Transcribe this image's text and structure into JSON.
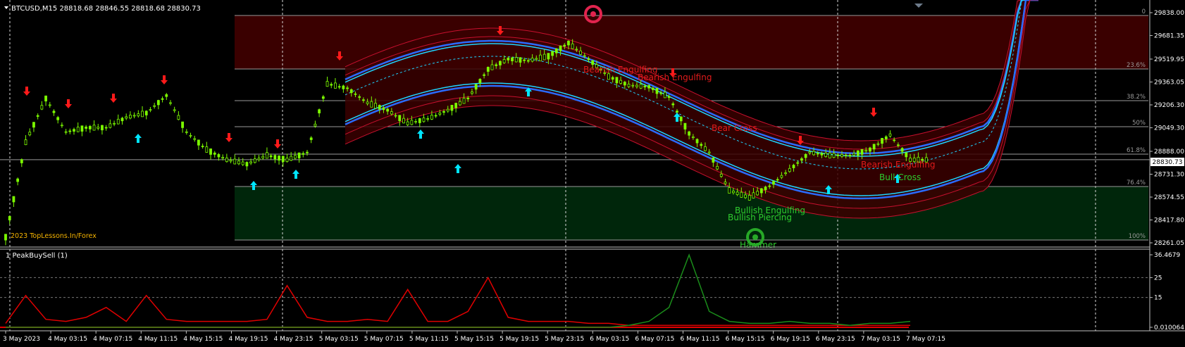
{
  "header": {
    "symbol_text": "BTCUSD,M15  28818.68 28846.55 28818.68 28830.73",
    "watermark": "2023 TopLessons.In/Forex"
  },
  "indicator": {
    "title": "1 PeakBuySell (1)",
    "axis_labels": [
      "36.4679",
      "25",
      "15",
      "0.010064"
    ]
  },
  "price_axis": {
    "labels": [
      "29838.00",
      "29681.35",
      "29519.95",
      "29363.05",
      "29206.30",
      "29049.30",
      "28888.00",
      "28731.30",
      "28574.55",
      "28417.80",
      "28261.05"
    ],
    "current_price": "28830.73"
  },
  "fibonacci": {
    "levels": [
      "0",
      "23.6%",
      "38.2%",
      "50%",
      "61.8%",
      "76.4%",
      "100%"
    ]
  },
  "time_axis": {
    "labels": [
      "3 May 2023",
      "4 May 03:15",
      "4 May 07:15",
      "4 May 11:15",
      "4 May 15:15",
      "4 May 19:15",
      "4 May 23:15",
      "5 May 03:15",
      "5 May 07:15",
      "5 May 11:15",
      "5 May 15:15",
      "5 May 19:15",
      "5 May 23:15",
      "6 May 03:15",
      "6 May 07:15",
      "6 May 11:15",
      "6 May 15:15",
      "6 May 19:15",
      "6 May 23:15",
      "7 May 03:15",
      "7 May 07:15"
    ]
  },
  "patterns": {
    "bearish_engulfing": "Bearish Engulfing",
    "bear_cross": "Bear Cross",
    "bullish_engulfing": "Bullish Engulfing",
    "bullish_piercing": "Bullish Piercing",
    "hammer": "Hammer",
    "bull_cross": "Bull Cross"
  },
  "colors": {
    "background": "#000000",
    "candle": "#7cfc00",
    "bear_zone": "#3a0000",
    "bull_zone": "#00260b",
    "sell_arrow": "#ff1a1a",
    "buy_arrow": "#00e5ff",
    "band_blue": "#2a6bff",
    "band_cyan": "#1ed4ff",
    "band_red": "#c8102e",
    "indicator_red": "#e00000",
    "indicator_green": "#1a8c1a"
  },
  "chart_data": [
    {
      "type": "candlestick",
      "title": "BTCUSD,M15",
      "ylim": [
        28261.05,
        29838.0
      ],
      "series": [
        {
          "name": "price",
          "values": [
            28300,
            28950,
            29250,
            29020,
            29050,
            29050,
            29120,
            29150,
            29270,
            29020,
            28900,
            28830,
            28800,
            28860,
            28830,
            28880,
            29350,
            29320,
            29220,
            29170,
            29080,
            29110,
            29170,
            29250,
            29450,
            29520,
            29510,
            29540,
            29630,
            29520,
            29400,
            29340,
            29330,
            29260,
            29010,
            28880,
            28620,
            28570,
            28650,
            28760,
            28880,
            28860,
            28860,
            28900,
            29000,
            28830
          ]
        }
      ]
    },
    {
      "type": "line",
      "title": "1 PeakBuySell (1)",
      "ylim": [
        0.010064,
        36.4679
      ],
      "series": [
        {
          "name": "",
          "values": [
            2,
            16,
            4,
            3,
            5,
            10,
            3,
            16,
            4,
            3,
            3,
            3,
            3,
            4,
            21,
            5,
            3,
            3,
            4,
            3,
            19,
            3,
            3,
            8,
            25,
            5,
            3,
            3,
            3,
            2,
            2,
            1,
            1,
            1,
            1,
            1,
            1,
            1,
            1,
            1,
            1,
            1,
            1,
            1,
            1,
            1
          ]
        },
        {
          "name": "",
          "values": [
            0,
            0,
            0,
            0,
            0,
            0,
            0,
            0,
            0,
            0,
            0,
            0,
            0,
            0,
            0,
            0,
            0,
            0,
            0,
            0,
            0,
            0,
            0,
            0,
            0,
            0,
            0,
            0,
            0,
            0,
            0,
            1,
            3,
            10,
            36.4,
            8,
            3,
            2,
            2,
            3,
            2,
            2,
            1,
            2,
            2,
            3
          ]
        }
      ]
    }
  ]
}
